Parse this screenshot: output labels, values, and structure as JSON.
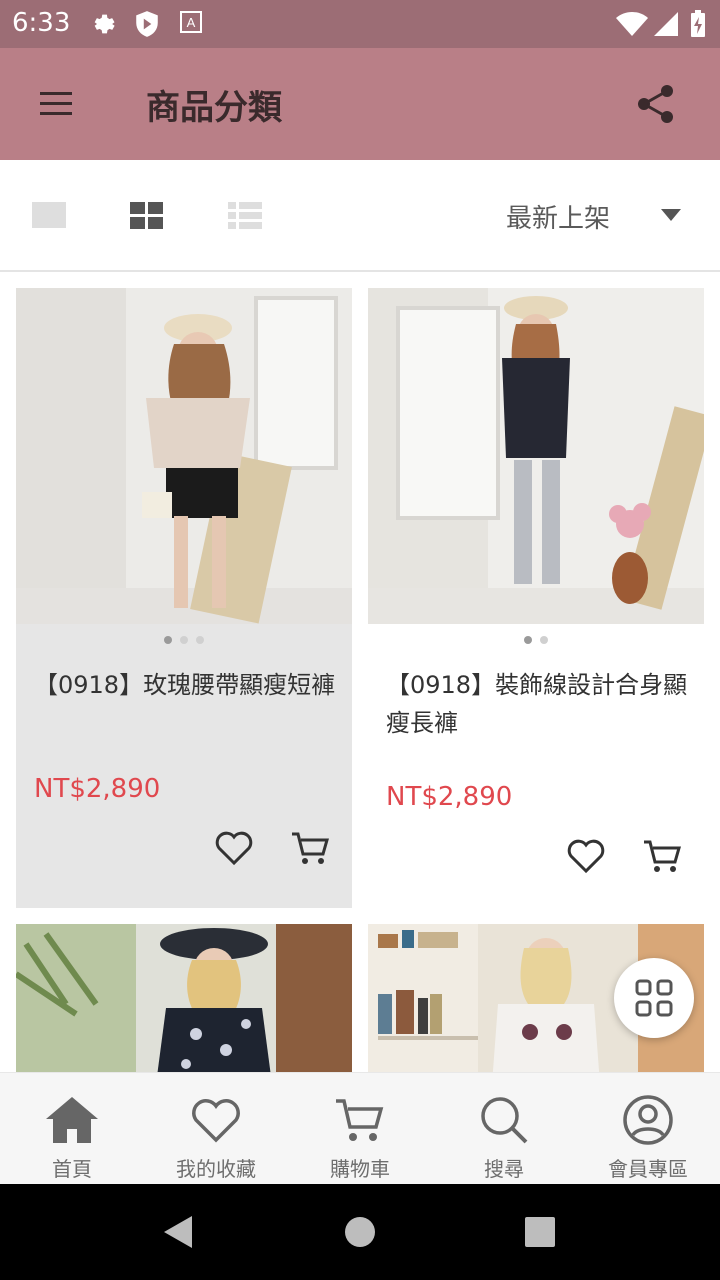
{
  "status_bar": {
    "time": "6:33"
  },
  "app_bar": {
    "title": "商品分類"
  },
  "view_bar": {
    "sort_label": "最新上架"
  },
  "products": [
    {
      "name": "【0918】玫瑰腰帶顯瘦短褲",
      "price": "NT$2,890",
      "dots": 3,
      "active_dot": 0
    },
    {
      "name": "【0918】裝飾線設計合身顯瘦長褲",
      "price": "NT$2,890",
      "dots": 2,
      "active_dot": 0
    },
    {
      "name": "",
      "price": ""
    },
    {
      "name": "",
      "price": ""
    }
  ],
  "bottom_nav": [
    {
      "label": "首頁",
      "icon": "home-icon"
    },
    {
      "label": "我的收藏",
      "icon": "heart-icon"
    },
    {
      "label": "購物車",
      "icon": "cart-icon"
    },
    {
      "label": "搜尋",
      "icon": "search-icon"
    },
    {
      "label": "會員專區",
      "icon": "account-icon"
    }
  ],
  "colors": {
    "status_bar": "#9c6d75",
    "app_bar": "#b97f87",
    "price": "#e0484e"
  }
}
